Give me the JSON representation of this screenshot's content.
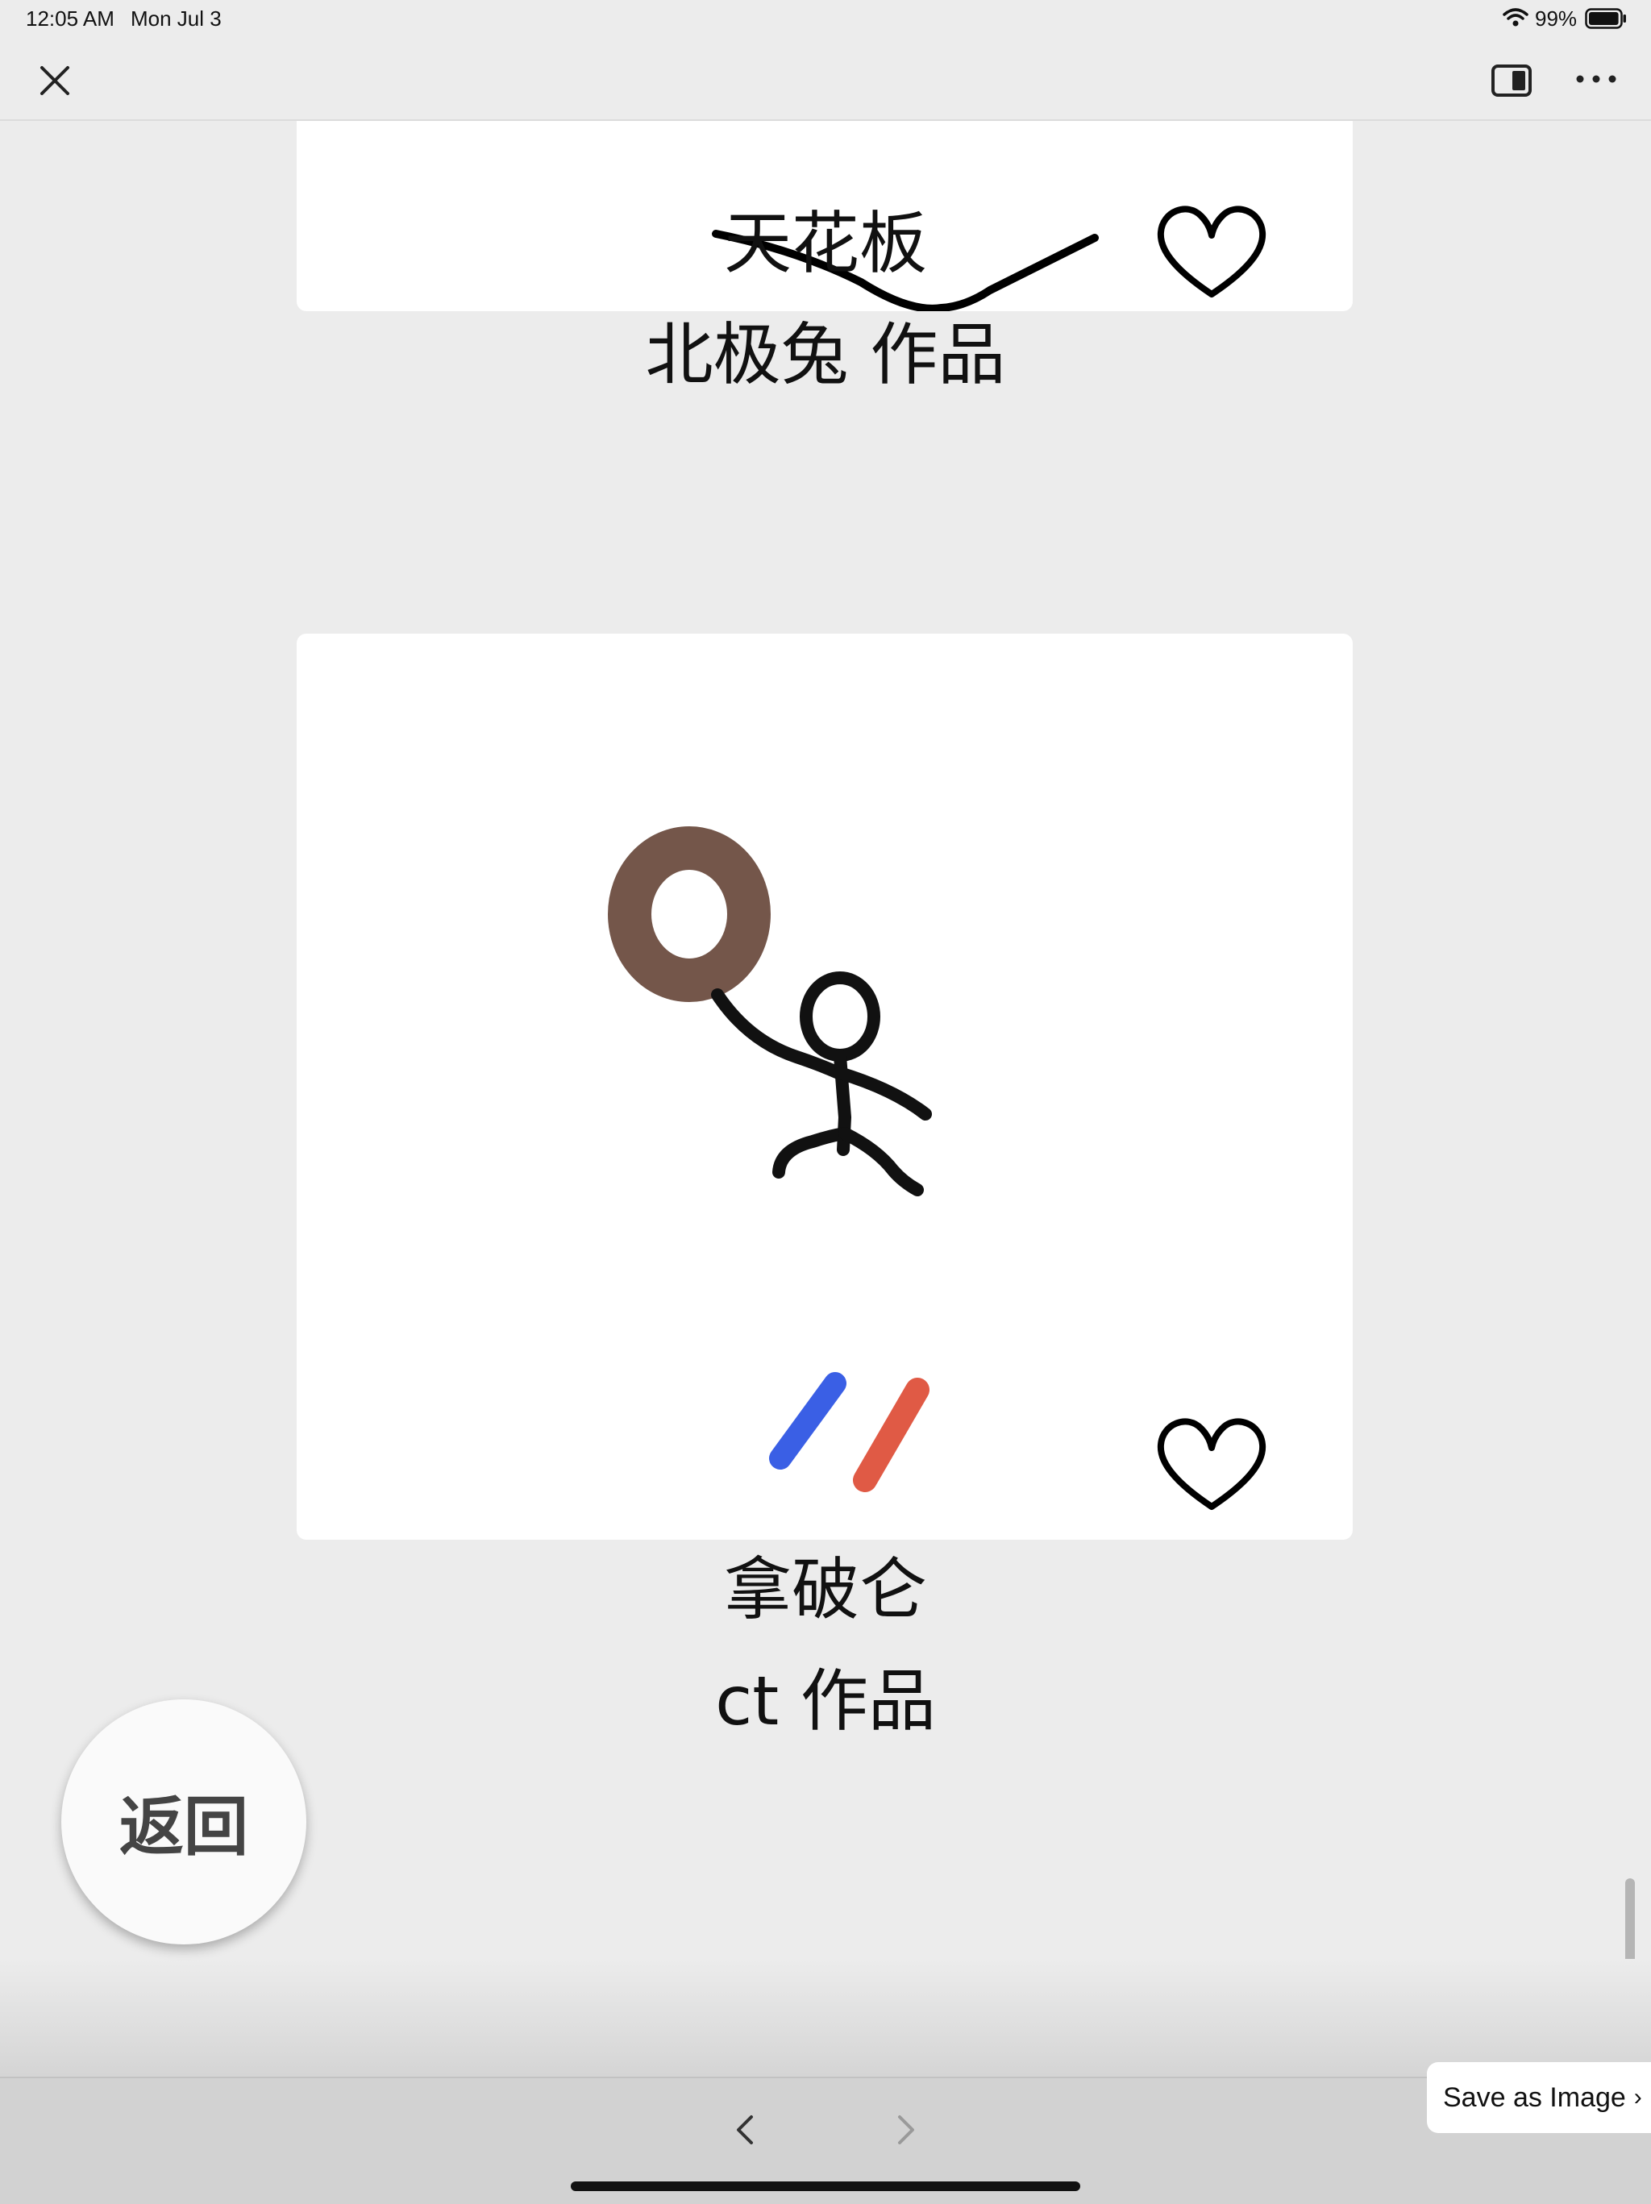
{
  "status_bar": {
    "time": "12:05 AM",
    "date": "Mon Jul 3",
    "battery_percent": "99%",
    "battery_level": 0.99
  },
  "toolbar": {
    "close_icon": "close-icon",
    "split_view_icon": "split-view-icon",
    "more_icon": "more-icon"
  },
  "artworks": [
    {
      "title": "天花板",
      "author_line": "北极兔 作品",
      "like_icon": "heart-icon"
    },
    {
      "title": "拿破仑",
      "author_line": "ct 作品",
      "like_icon": "heart-icon",
      "colors": {
        "hat": "#74564a",
        "stroke": "#111111",
        "blue": "#3a5fe5",
        "red": "#e05a45"
      }
    }
  ],
  "back_button": {
    "label": "返回"
  },
  "save_button": {
    "label": "Save as Image"
  },
  "nav": {
    "back_icon": "chevron-left-icon",
    "forward_icon": "chevron-right-icon"
  }
}
